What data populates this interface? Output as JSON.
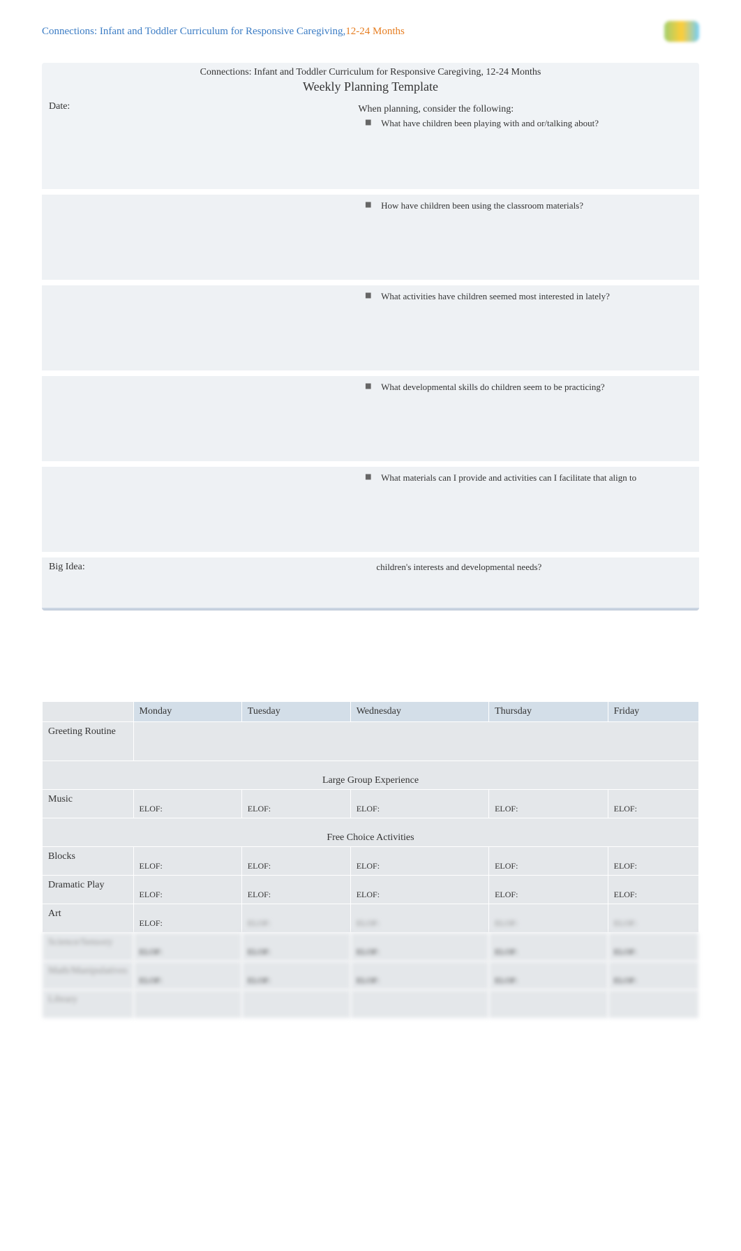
{
  "header": {
    "title_blue": "Connections: Infant and Toddler Curriculum for Responsive Caregiving,",
    "title_orange": "12-24 Months"
  },
  "planning": {
    "full_title": "Connections: Infant and Toddler Curriculum for Responsive Caregiving, 12-24 Months",
    "subtitle": "Weekly Planning Template",
    "date_label": "Date:",
    "consider_intro": "When planning, consider the following:",
    "questions": [
      "What have children been playing with and or/talking about?",
      "How have children been using the classroom materials?",
      "What activities have children seemed most interested in lately?",
      "What developmental skills do children seem to be practicing?",
      "What materials can I provide and activities can I facilitate that align to"
    ],
    "big_idea_label": "Big Idea:",
    "question_tail": "children's interests and developmental needs?"
  },
  "schedule": {
    "days": [
      "Monday",
      "Tuesday",
      "Wednesday",
      "Thursday",
      "Friday"
    ],
    "rows": {
      "greeting": "Greeting Routine",
      "large_group": "Large Group Experience",
      "music": "Music",
      "free_choice": "Free Choice Activities",
      "blocks": "Blocks",
      "dramatic": "Dramatic Play",
      "art": "Art",
      "blurred1": "Science/Sensory",
      "blurred2": "Math/Manipulatives",
      "blurred3": "Library"
    },
    "elof_label": "ELOF:"
  }
}
